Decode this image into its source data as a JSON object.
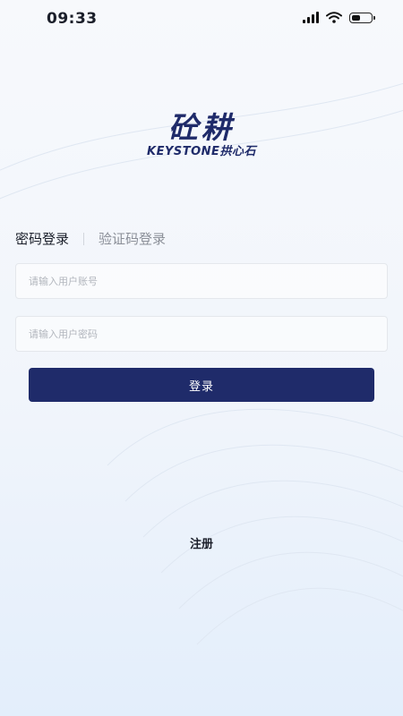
{
  "status_bar": {
    "time": "09:33"
  },
  "logo": {
    "title_cn": "砼耕",
    "subtitle": "KEYSTONE拱心石"
  },
  "tabs": {
    "active": "密码登录",
    "inactive": "验证码登录"
  },
  "form": {
    "account_placeholder": "请输入用户账号",
    "password_placeholder": "请输入用户密码",
    "login_label": "登录"
  },
  "footer": {
    "register_label": "注册"
  },
  "colors": {
    "brand": "#1f2b6a",
    "inactive_text": "#8b8f98"
  },
  "icons": [
    "cellular-signal-icon",
    "wifi-icon",
    "battery-icon"
  ]
}
